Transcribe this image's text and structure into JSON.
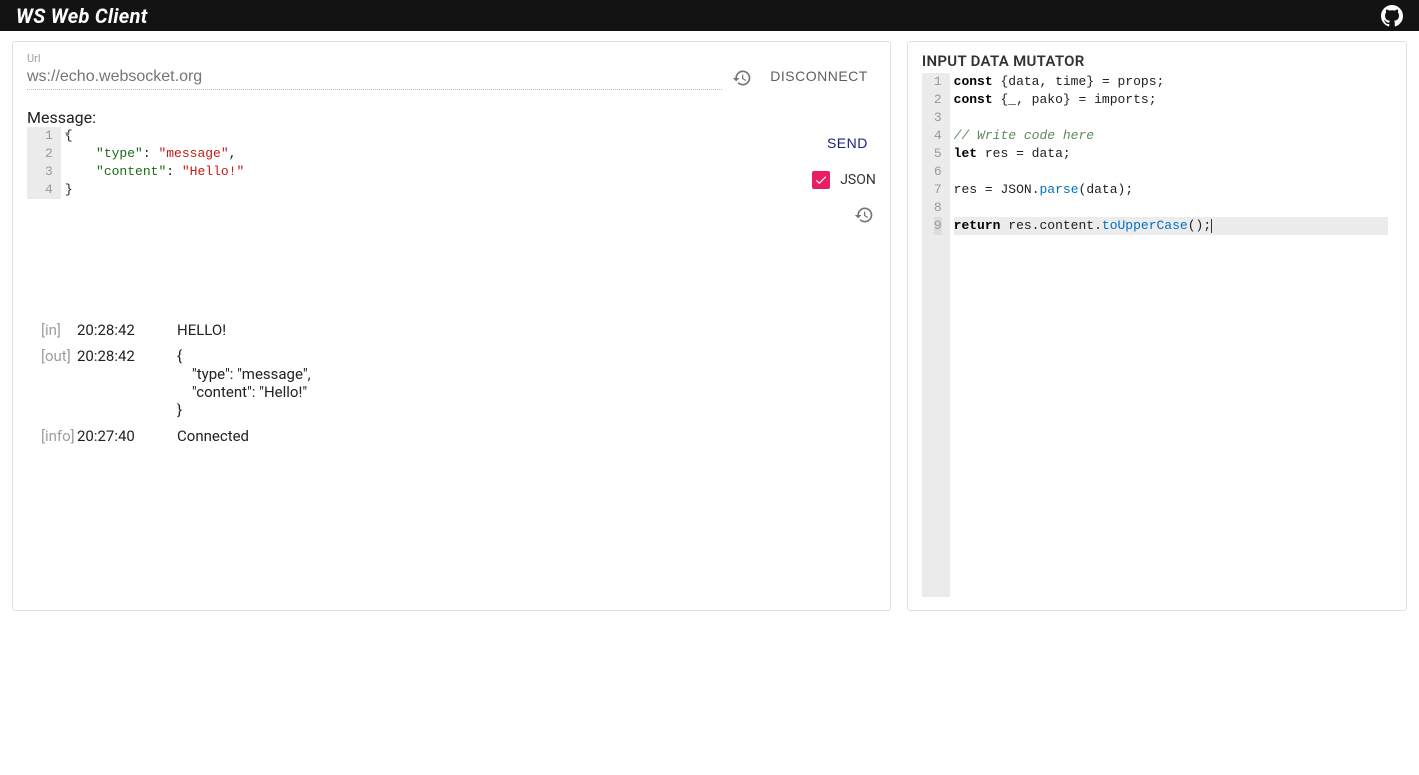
{
  "header": {
    "title": "WS Web Client",
    "github_icon": "github-icon"
  },
  "left": {
    "url_label": "Url",
    "url_placeholder": "ws://echo.websocket.org",
    "history_icon": "history-icon",
    "disconnect_label": "DISCONNECT",
    "message_label": "Message:",
    "send_label": "SEND",
    "json_label": "JSON",
    "json_checked": true,
    "message_lines": [
      "{",
      "    \"type\": \"message\",",
      "    \"content\": \"Hello!\"",
      "}"
    ],
    "log": [
      {
        "tag": "[in]",
        "time": "20:28:42",
        "body": "HELLO!"
      },
      {
        "tag": "[out]",
        "time": "20:28:42",
        "body": "{\n    \"type\": \"message\",\n    \"content\": \"Hello!\"\n}"
      },
      {
        "tag": "[info]",
        "time": "20:27:40",
        "body": "Connected"
      }
    ]
  },
  "right": {
    "title": "INPUT DATA MUTATOR",
    "lines_html": [
      "<span class='tok-kw'>const</span> {data, time} = props;",
      "<span class='tok-kw'>const</span> {_, pako} = imports;",
      "",
      "<span class='tok-comment'>// Write code here</span>",
      "<span class='tok-kw'>let</span> res = data;",
      "",
      "res = <span class='tok-var'>JSON</span>.<span class='tok-fn'>parse</span>(data);",
      "",
      "<span class='tok-kw'>return</span> res.content.<span class='tok-fn'>toUpperCase</span>();<span class='cursor-bar'></span>"
    ],
    "active_line": 9
  }
}
